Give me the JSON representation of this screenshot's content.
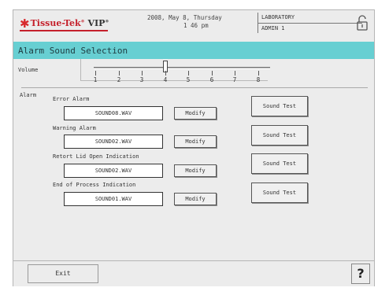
{
  "header": {
    "logo_brand": "Tissue-Tek",
    "logo_product": "VIP",
    "date_line1": "2008, May 8, Thursday",
    "date_line2": "1 46 pm",
    "location": "LABORATORY",
    "user": "ADMIN 1",
    "lock_icon": "lock-icon"
  },
  "title": "Alarm Sound Selection",
  "volume": {
    "label": "Volume",
    "ticks": [
      "1",
      "2",
      "3",
      "4",
      "5",
      "6",
      "7",
      "8"
    ],
    "value": 4
  },
  "alarm_section_label": "Alarm",
  "alarms": [
    {
      "name": "Error Alarm",
      "file": "SOUND08.WAV",
      "modify": "Modify",
      "test": "Sound Test"
    },
    {
      "name": "Warning Alarm",
      "file": "SOUND02.WAV",
      "modify": "Modify",
      "test": "Sound Test"
    },
    {
      "name": "Retort Lid Open Indication",
      "file": "SOUND02.WAV",
      "modify": "Modify",
      "test": "Sound Test"
    },
    {
      "name": "End of Process Indication",
      "file": "SOUND01.WAV",
      "modify": "Modify",
      "test": "Sound Test"
    }
  ],
  "footer": {
    "exit": "Exit",
    "help": "?"
  }
}
